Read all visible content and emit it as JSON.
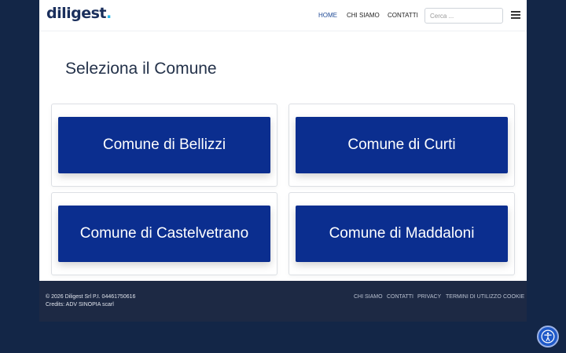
{
  "brand": {
    "name": "diligest",
    "dot": "."
  },
  "nav": {
    "home": "HOME",
    "chi_siamo": "CHI SIAMO",
    "contatti": "CONTATTI"
  },
  "search": {
    "placeholder": "Cerca ..."
  },
  "main": {
    "title": "Seleziona il Comune",
    "comuni": [
      {
        "label": "Comune di Bellizzi"
      },
      {
        "label": "Comune di Curti"
      },
      {
        "label": "Comune di Castelvetrano"
      },
      {
        "label": "Comune di Maddaloni"
      }
    ]
  },
  "footer": {
    "copyright": "© 2026 Diligest Srl P.I. 04461750616",
    "credits": "Credits: ADV SINOPIA scarl",
    "links": [
      "CHI SIAMO",
      "CONTATTI",
      "PRIVACY",
      "TERMINI DI UTILIZZO",
      "COOKIE"
    ]
  },
  "colors": {
    "background": "#132647",
    "button": "#0b2e8f",
    "brand_dot": "#28b6e8",
    "footer": "#1d2944",
    "nav_active": "#1f4a96"
  },
  "icons": {
    "menu": "hamburger-menu-icon",
    "accessibility": "accessibility-icon"
  }
}
